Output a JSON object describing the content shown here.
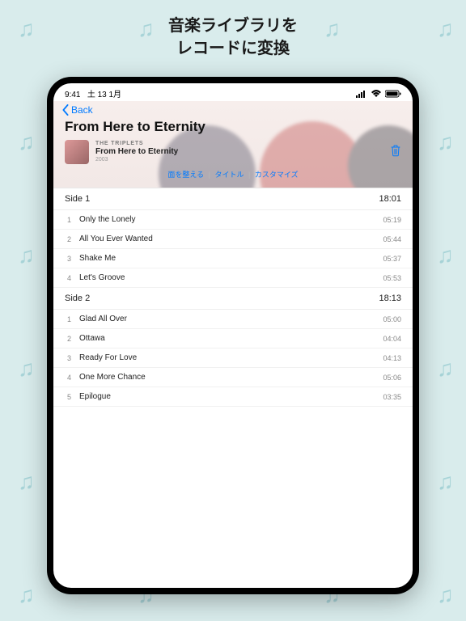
{
  "promo": {
    "title": "音楽ライブラリを\nレコードに変換"
  },
  "status": {
    "time": "9:41",
    "date": "土 13 1月"
  },
  "nav": {
    "back": "Back"
  },
  "album": {
    "title": "From Here to Eternity",
    "artist": "The Triplets",
    "name": "From Here to Eternity",
    "year": "2003"
  },
  "actions": {
    "adjust": "面を整える",
    "title": "タイトル",
    "customize": "カスタマイズ",
    "sep": "|"
  },
  "sides": [
    {
      "label": "Side 1",
      "duration": "18:01",
      "tracks": [
        {
          "num": "1",
          "name": "Only the Lonely",
          "dur": "05:19"
        },
        {
          "num": "2",
          "name": "All You Ever Wanted",
          "dur": "05:44"
        },
        {
          "num": "3",
          "name": "Shake Me",
          "dur": "05:37"
        },
        {
          "num": "4",
          "name": "Let's Groove",
          "dur": "05:53"
        }
      ]
    },
    {
      "label": "Side 2",
      "duration": "18:13",
      "tracks": [
        {
          "num": "1",
          "name": "Glad All Over",
          "dur": "05:00"
        },
        {
          "num": "2",
          "name": "Ottawa",
          "dur": "04:04"
        },
        {
          "num": "3",
          "name": "Ready For Love",
          "dur": "04:13"
        },
        {
          "num": "4",
          "name": "One More Chance",
          "dur": "05:06"
        },
        {
          "num": "5",
          "name": "Epilogue",
          "dur": "03:35"
        }
      ]
    }
  ]
}
